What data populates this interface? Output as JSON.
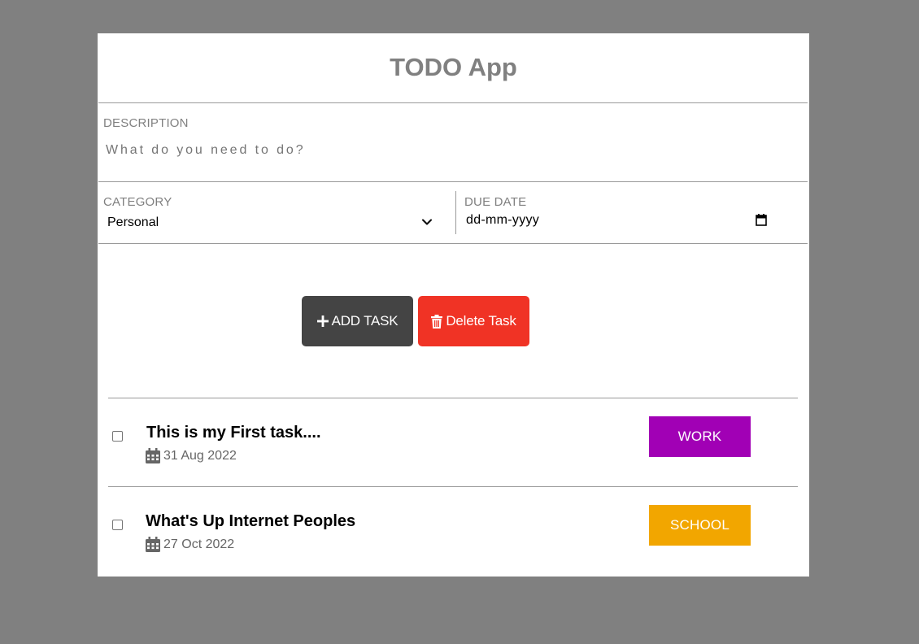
{
  "app": {
    "title": "TODO App"
  },
  "form": {
    "description": {
      "label": "DESCRIPTION",
      "placeholder": "What do you need to do?",
      "value": ""
    },
    "category": {
      "label": "CATEGORY",
      "selected": "Personal"
    },
    "due_date": {
      "label": "DUE DATE",
      "value": "dd-mm-yyyy"
    }
  },
  "actions": {
    "add_label": "ADD TASK",
    "delete_label": "Delete Task"
  },
  "tasks": [
    {
      "title": "This is my First task....",
      "date": "31 Aug 2022",
      "category": "WORK",
      "category_color": "#a100b5",
      "checked": false
    },
    {
      "title": "What's Up Internet Peoples",
      "date": "27 Oct 2022",
      "category": "SCHOOL",
      "category_color": "#f2a600",
      "checked": false
    }
  ],
  "colors": {
    "background": "#808080",
    "add_button": "#444444",
    "delete_button": "#f03325"
  },
  "icons": {
    "add": "plus-icon",
    "delete": "trash-icon",
    "date": "calendar-icon",
    "category_select": "chevron-down-icon",
    "date_picker": "calendar-picker-icon"
  }
}
